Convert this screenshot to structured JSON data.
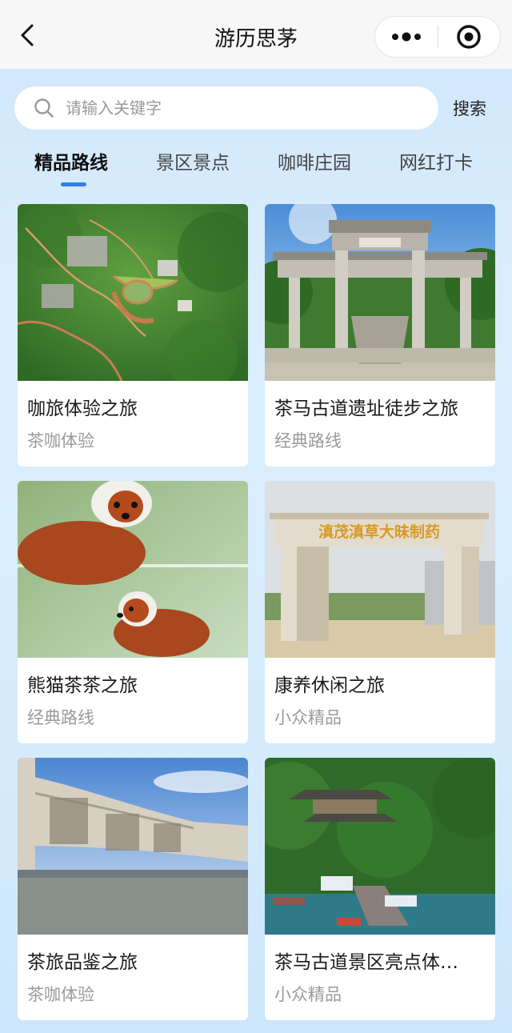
{
  "nav": {
    "back_icon": "chevron-left-icon",
    "title": "游历思茅",
    "more_icon": "more-dots-icon",
    "close_icon": "target-circle-icon"
  },
  "search": {
    "placeholder": "请输入关键字",
    "value": "",
    "icon": "search-icon",
    "button_label": "搜索"
  },
  "tabs": [
    {
      "label": "精品路线",
      "active": true
    },
    {
      "label": "景区景点",
      "active": false
    },
    {
      "label": "咖啡庄园",
      "active": false
    },
    {
      "label": "网红打卡",
      "active": false
    }
  ],
  "accent_color": "#2f7fe6",
  "cards": [
    {
      "title": "咖旅体验之旅",
      "subtitle": "茶咖体验",
      "image": "aerial-green-hills-photo"
    },
    {
      "title": "茶马古道遗址徒步之旅",
      "subtitle": "经典路线",
      "image": "stone-archway-photo"
    },
    {
      "title": "熊猫茶茶之旅",
      "subtitle": "经典路线",
      "image": "red-panda-photo"
    },
    {
      "title": "康养休闲之旅",
      "subtitle": "小众精品",
      "image": "pharmaceutical-gate-photo"
    },
    {
      "title": "茶旅品鉴之旅",
      "subtitle": "茶咖体验",
      "image": "carved-stone-pavilion-photo"
    },
    {
      "title": "茶马古道景区亮点体…",
      "subtitle": "小众精品",
      "image": "lake-pavilion-photo"
    }
  ],
  "card_images_text": {
    "gate_sign": "滇茂滇草大昧制药"
  }
}
